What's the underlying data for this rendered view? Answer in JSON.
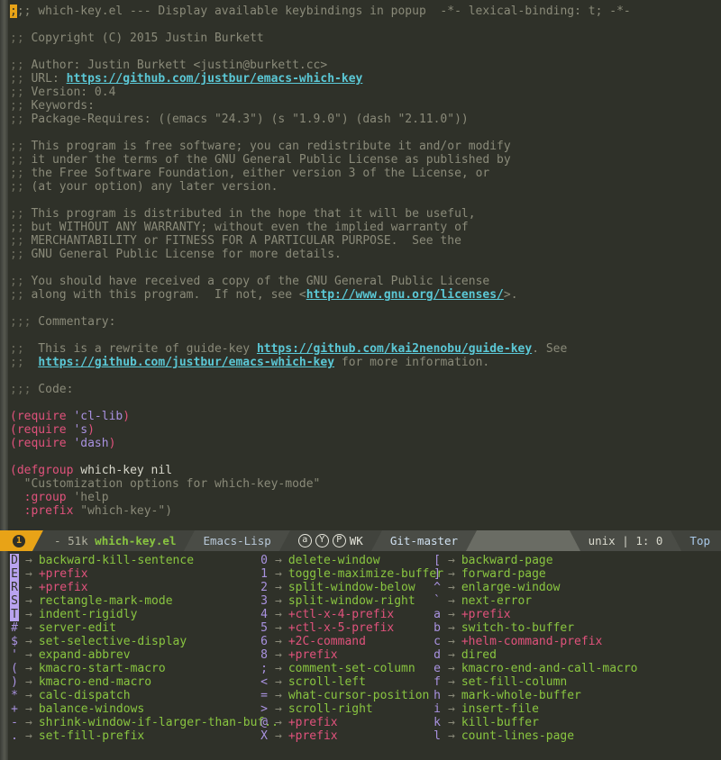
{
  "window": {
    "title": "which-key.el",
    "fringe_color": "#4a4c46",
    "background": "#2f3129"
  },
  "buffer": {
    "name": "which-key.el",
    "first_line": ";;; which-key.el --- Display available keybindings in popup  -*- lexical-binding: t; -*-",
    "cursor_char": ";",
    "lines": [
      {
        "type": "header",
        "text": ";;; which-key.el --- Display available keybindings in popup  -*- lexical-binding: t; -*-"
      },
      {
        "type": "blank",
        "text": ""
      },
      {
        "type": "comment",
        "text": ";; Copyright (C) 2015 Justin Burkett"
      },
      {
        "type": "blank",
        "text": ""
      },
      {
        "type": "comment",
        "text": ";; Author: Justin Burkett <justin@burkett.cc>"
      },
      {
        "type": "comment-link",
        "prefix": ";; URL: ",
        "link": "https://github.com/justbur/emacs-which-key",
        "suffix": ""
      },
      {
        "type": "comment",
        "text": ";; Version: 0.4"
      },
      {
        "type": "comment",
        "text": ";; Keywords:"
      },
      {
        "type": "comment",
        "text": ";; Package-Requires: ((emacs \"24.3\") (s \"1.9.0\") (dash \"2.11.0\"))"
      },
      {
        "type": "blank",
        "text": ""
      },
      {
        "type": "comment",
        "text": ";; This program is free software; you can redistribute it and/or modify"
      },
      {
        "type": "comment",
        "text": ";; it under the terms of the GNU General Public License as published by"
      },
      {
        "type": "comment",
        "text": ";; the Free Software Foundation, either version 3 of the License, or"
      },
      {
        "type": "comment",
        "text": ";; (at your option) any later version."
      },
      {
        "type": "blank",
        "text": ""
      },
      {
        "type": "comment",
        "text": ";; This program is distributed in the hope that it will be useful,"
      },
      {
        "type": "comment",
        "text": ";; but WITHOUT ANY WARRANTY; without even the implied warranty of"
      },
      {
        "type": "comment",
        "text": ";; MERCHANTABILITY or FITNESS FOR A PARTICULAR PURPOSE.  See the"
      },
      {
        "type": "comment",
        "text": ";; GNU General Public License for more details."
      },
      {
        "type": "blank",
        "text": ""
      },
      {
        "type": "comment",
        "text": ";; You should have received a copy of the GNU General Public License"
      },
      {
        "type": "comment-link",
        "prefix": ";; along with this program.  If not, see <",
        "link": "http://www.gnu.org/licenses/",
        "suffix": ">."
      },
      {
        "type": "blank",
        "text": ""
      },
      {
        "type": "comment",
        "text": ";;; Commentary:"
      },
      {
        "type": "blank",
        "text": ""
      },
      {
        "type": "comment-link",
        "prefix": ";;  This is a rewrite of guide-key ",
        "link": "https://github.com/kai2nenobu/guide-key",
        "suffix": ". See"
      },
      {
        "type": "comment-link",
        "prefix": ";;  ",
        "link": "https://github.com/justbur/emacs-which-key",
        "suffix": " for more information."
      },
      {
        "type": "blank",
        "text": ""
      },
      {
        "type": "comment",
        "text": ";;; Code:"
      },
      {
        "type": "blank",
        "text": ""
      },
      {
        "type": "code-require",
        "fn": "require",
        "arg": "'cl-lib"
      },
      {
        "type": "code-require",
        "fn": "require",
        "arg": "'s"
      },
      {
        "type": "code-require",
        "fn": "require",
        "arg": "'dash"
      },
      {
        "type": "blank",
        "text": ""
      },
      {
        "type": "defgroup-open",
        "kw": "defgroup",
        "name": "which-key",
        "nil_word": "nil"
      },
      {
        "type": "docstring",
        "text": "  \"Customization options for which-key-mode\""
      },
      {
        "type": "plist",
        "key": "  :group",
        "value": " 'help"
      },
      {
        "type": "plist",
        "key": "  :prefix",
        "value": " \"which-key-\")"
      }
    ]
  },
  "modeline": {
    "window_number": "1",
    "modified_indicator": "-",
    "buffer_size": "51k",
    "buffer_name": "which-key.el",
    "major_mode": "Emacs-Lisp",
    "minor_modes": [
      "a",
      "Y",
      "P"
    ],
    "minor_modes_label": "WK",
    "vc": "Git-master",
    "encoding": "unix",
    "separator": "|",
    "position": "1: 0",
    "scroll": "Top",
    "colors": {
      "window_number_bg": "#e8a317",
      "buffer_bg": "#41433d",
      "mode_bg": "#4a4c46",
      "fill_bg": "#6a6c64",
      "buffer_name_fg": "#89c540"
    }
  },
  "which_key": {
    "separator": "→",
    "highlighted_keys": [
      "D",
      "E",
      "R",
      "S",
      "T"
    ],
    "columns": [
      {
        "entries": [
          {
            "key": "D",
            "cmd": "backward-kill-sentence",
            "prefix": false,
            "highlight": true
          },
          {
            "key": "E",
            "cmd": "+prefix",
            "prefix": true,
            "highlight": true
          },
          {
            "key": "R",
            "cmd": "+prefix",
            "prefix": true,
            "highlight": true
          },
          {
            "key": "S",
            "cmd": "rectangle-mark-mode",
            "prefix": false,
            "highlight": true
          },
          {
            "key": "T",
            "cmd": "indent-rigidly",
            "prefix": false,
            "highlight": true
          },
          {
            "key": "#",
            "cmd": "server-edit",
            "prefix": false,
            "highlight": false
          },
          {
            "key": "$",
            "cmd": "set-selective-display",
            "prefix": false,
            "highlight": false
          },
          {
            "key": "'",
            "cmd": "expand-abbrev",
            "prefix": false,
            "highlight": false
          },
          {
            "key": "(",
            "cmd": "kmacro-start-macro",
            "prefix": false,
            "highlight": false
          },
          {
            "key": ")",
            "cmd": "kmacro-end-macro",
            "prefix": false,
            "highlight": false
          },
          {
            "key": "*",
            "cmd": "calc-dispatch",
            "prefix": false,
            "highlight": false
          },
          {
            "key": "+",
            "cmd": "balance-windows",
            "prefix": false,
            "highlight": false
          },
          {
            "key": "-",
            "cmd": "shrink-window-if-larger-than-buf..",
            "prefix": false,
            "highlight": false
          },
          {
            "key": ".",
            "cmd": "set-fill-prefix",
            "prefix": false,
            "highlight": false
          }
        ]
      },
      {
        "entries": [
          {
            "key": "0",
            "cmd": "delete-window",
            "prefix": false,
            "highlight": false
          },
          {
            "key": "1",
            "cmd": "toggle-maximize-buffer",
            "prefix": false,
            "highlight": false
          },
          {
            "key": "2",
            "cmd": "split-window-below",
            "prefix": false,
            "highlight": false
          },
          {
            "key": "3",
            "cmd": "split-window-right",
            "prefix": false,
            "highlight": false
          },
          {
            "key": "4",
            "cmd": "+ctl-x-4-prefix",
            "prefix": true,
            "highlight": false
          },
          {
            "key": "5",
            "cmd": "+ctl-x-5-prefix",
            "prefix": true,
            "highlight": false
          },
          {
            "key": "6",
            "cmd": "+2C-command",
            "prefix": true,
            "highlight": false
          },
          {
            "key": "8",
            "cmd": "+prefix",
            "prefix": true,
            "highlight": false
          },
          {
            "key": ";",
            "cmd": "comment-set-column",
            "prefix": false,
            "highlight": false
          },
          {
            "key": "<",
            "cmd": "scroll-left",
            "prefix": false,
            "highlight": false
          },
          {
            "key": "=",
            "cmd": "what-cursor-position",
            "prefix": false,
            "highlight": false
          },
          {
            "key": ">",
            "cmd": "scroll-right",
            "prefix": false,
            "highlight": false
          },
          {
            "key": "@",
            "cmd": "+prefix",
            "prefix": true,
            "highlight": false
          },
          {
            "key": "X",
            "cmd": "+prefix",
            "prefix": true,
            "highlight": false
          }
        ]
      },
      {
        "entries": [
          {
            "key": "[",
            "cmd": "backward-page",
            "prefix": false,
            "highlight": false
          },
          {
            "key": "]",
            "cmd": "forward-page",
            "prefix": false,
            "highlight": false
          },
          {
            "key": "^",
            "cmd": "enlarge-window",
            "prefix": false,
            "highlight": false
          },
          {
            "key": "`",
            "cmd": "next-error",
            "prefix": false,
            "highlight": false
          },
          {
            "key": "a",
            "cmd": "+prefix",
            "prefix": true,
            "highlight": false
          },
          {
            "key": "b",
            "cmd": "switch-to-buffer",
            "prefix": false,
            "highlight": false
          },
          {
            "key": "c",
            "cmd": "+helm-command-prefix",
            "prefix": true,
            "highlight": false
          },
          {
            "key": "d",
            "cmd": "dired",
            "prefix": false,
            "highlight": false
          },
          {
            "key": "e",
            "cmd": "kmacro-end-and-call-macro",
            "prefix": false,
            "highlight": false
          },
          {
            "key": "f",
            "cmd": "set-fill-column",
            "prefix": false,
            "highlight": false
          },
          {
            "key": "h",
            "cmd": "mark-whole-buffer",
            "prefix": false,
            "highlight": false
          },
          {
            "key": "i",
            "cmd": "insert-file",
            "prefix": false,
            "highlight": false
          },
          {
            "key": "k",
            "cmd": "kill-buffer",
            "prefix": false,
            "highlight": false
          },
          {
            "key": "l",
            "cmd": "count-lines-page",
            "prefix": false,
            "highlight": false
          }
        ]
      }
    ]
  }
}
